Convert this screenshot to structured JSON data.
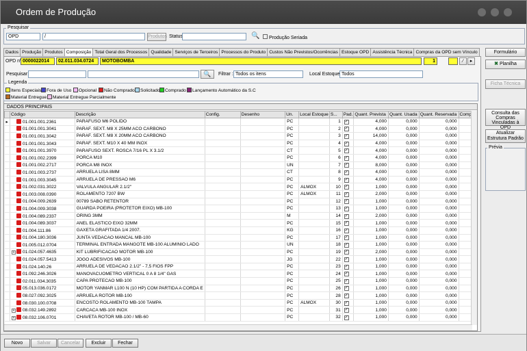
{
  "window": {
    "title": "Ordem de Produção"
  },
  "pesquisar": {
    "legend": "Pesquisar",
    "type_value": "OPD",
    "number_value": "/",
    "produtos_label": "Produtos",
    "status_label": "Status",
    "producao_seriada_label": "Produção Seriada"
  },
  "tabs": [
    "Dados",
    "Produção",
    "Produtos",
    "Composição",
    "Total Geral dos Processos",
    "Qualidade",
    "Serviços de Terceiros",
    "Processos do Produto",
    "Custos Não Previstos/Ocorrências",
    "Estoque OPD",
    "Assistência Técnica",
    "Compras da OPD sem Vínculo"
  ],
  "active_tab": "Composição",
  "opd": {
    "label": "OPD nº",
    "number": "0000022014",
    "code": "02.011.034.0724",
    "name": "MOTOBOMBA",
    "qty": "1"
  },
  "filters": {
    "pesquisar_label": "Pesquisar:",
    "filtrar_label": "Filtrar :",
    "filtrar_value": "Todos os itens",
    "local_estoque_label": "Local Estoque :",
    "local_estoque_value": "Todos"
  },
  "legenda": {
    "title": "Legenda",
    "items": [
      {
        "label": "Itens Especiais",
        "color": "#ffff33"
      },
      {
        "label": "Fora de Uso",
        "color": "#4444cc"
      },
      {
        "label": "Opcional",
        "color": "#f4b8f4"
      },
      {
        "label": "Não Comprado",
        "color": "#dd2222"
      },
      {
        "label": "Solicitado",
        "color": "#a8d8ee"
      },
      {
        "label": "Comprado",
        "color": "#22cc22"
      },
      {
        "label": "Lançamento Automático da S.C",
        "color": "#882277"
      },
      {
        "label": "Material Entregue",
        "color": "#b86a22"
      },
      {
        "label": "Material Entregue Parcialmente",
        "color": "#f0c0e8"
      }
    ]
  },
  "grid": {
    "section_title": "DADOS PRINCIPAIS",
    "columns": [
      "Código",
      "Descrição",
      "Config.",
      "Desenho",
      "Un.",
      "Local Estoque",
      "S...",
      "Pad.",
      "Quant. Prevista",
      "Quant. Usada",
      "Quant. Reservada",
      "Compra"
    ],
    "rows": [
      [
        "01.001.001.2361",
        "PARAFUSO M6 POLIDO",
        "",
        "",
        "PC",
        "",
        "1",
        "4,000",
        "0,000",
        "0,000"
      ],
      [
        "01.001.001.3041",
        "PARAF. SEXT. M8 X 25MM ACO CARBONO",
        "",
        "",
        "PC",
        "",
        "2",
        "4,000",
        "0,000",
        "0,000"
      ],
      [
        "01.001.001.3042",
        "PARAF. SEXT. M8 X 20MM ACO CARBONO",
        "",
        "",
        "PC",
        "",
        "3",
        "14,000",
        "0,000",
        "0,000"
      ],
      [
        "01.001.001.3043",
        "PARAF. SEXT. M10 X 40 MM INOX",
        "",
        "",
        "PC",
        "",
        "4",
        "4,000",
        "0,000",
        "0,000"
      ],
      [
        "01.001.001.3970",
        "PARAFUSO SEXT. ROSCA 7/16 PL X 3.1/2",
        "",
        "",
        "CT",
        "",
        "5",
        "4,000",
        "0,000",
        "0,000"
      ],
      [
        "01.001.002.2399",
        "PORCA M10",
        "",
        "",
        "PC",
        "",
        "6",
        "4,000",
        "0,000",
        "0,000"
      ],
      [
        "01.001.002.2717",
        "PORCA M8 INOX",
        "",
        "",
        "UN",
        "",
        "7",
        "8,000",
        "0,000",
        "0,000"
      ],
      [
        "01.001.003.2737",
        "ARRUELA LISA 8MM",
        "",
        "",
        "CT",
        "",
        "8",
        "4,000",
        "0,000",
        "0,000"
      ],
      [
        "01.001.003.3045",
        "ARRUELA DE PRESSAO M6",
        "",
        "",
        "PC",
        "",
        "9",
        "4,000",
        "0,000",
        "0,000"
      ],
      [
        "01.002.031.3022",
        "VALVULA ANGULAR 2.1/2\"",
        "",
        "",
        "PC",
        "ALMOX",
        "10",
        "1,000",
        "0,000",
        "0,000"
      ],
      [
        "01.003.008.0390",
        "ROLAMENTO 7207 BW",
        "",
        "",
        "PC",
        "ALMOX",
        "11",
        "2,000",
        "0,000",
        "0,000"
      ],
      [
        "01.004.009.2639",
        "00789 SABO RETENTOR",
        "",
        "",
        "PC",
        "",
        "12",
        "1,000",
        "0,000",
        "0,000"
      ],
      [
        "01.004.009.3038",
        "GUARDA POEIRA (PROTETOR EIXO) MB-100",
        "",
        "",
        "PC",
        "",
        "13",
        "1,000",
        "0,000",
        "0,000"
      ],
      [
        "01.004.089.2337",
        "ORING 3MM",
        "",
        "",
        "M",
        "",
        "14",
        "2,000",
        "0,000",
        "0,000"
      ],
      [
        "01.004.089.3037",
        "ANEL ELASTICO EIXO 32MM",
        "",
        "",
        "PC",
        "",
        "15",
        "1,000",
        "0,000",
        "0,000"
      ],
      [
        "01.004.111.86",
        "GAXETA GRAFITADA 1/4 2007.",
        "",
        "",
        "KG",
        "",
        "16",
        "1,000",
        "0,000",
        "0,000"
      ],
      [
        "01.004.180.3036",
        "JUNTA VEDACAO MANCAL MB-100",
        "",
        "",
        "PC",
        "",
        "17",
        "1,000",
        "0,000",
        "0,000"
      ],
      [
        "01.005.012.0704",
        "TERMINAL ENTRADA MANGOTE MB-100 ALUMINIO LADO",
        "",
        "",
        "UN",
        "",
        "18",
        "1,000",
        "0,000",
        "0,000"
      ],
      [
        "01.024.057.4635",
        "KIT LUBRIFICACAO MOTOR MB-100",
        "",
        "",
        "PC",
        "",
        "19",
        "2,000",
        "0,000",
        "0,000"
      ],
      [
        "01.024.057.5413",
        "JOGO ADESIVOS MB-100",
        "",
        "",
        "JG",
        "",
        "22",
        "1,000",
        "0,000",
        "0,000"
      ],
      [
        "01.024.140.26",
        "ARRUELA DE VEDACAO 2.1/2\" - 7,5 FIOS FPP",
        "",
        "",
        "PC",
        "",
        "23",
        "1,000",
        "0,000",
        "0,000"
      ],
      [
        "01.092.246.3026",
        "MANOVACUOMETRO VERTICAL 0 A 8 1/4\" GAS",
        "",
        "",
        "PC",
        "",
        "24",
        "1,000",
        "0,000",
        "0,000"
      ],
      [
        "02.011.034.3035",
        "CAPA PROTECAO MB-100",
        "",
        "",
        "PC",
        "",
        "25",
        "1,000",
        "0,000",
        "0,000"
      ],
      [
        "05.013.036.0172",
        "MOTOR YANMAR L100 N (10 HP) COM PARTIDA A CORDA E",
        "",
        "",
        "PC",
        "",
        "26",
        "1,000",
        "0,000",
        "0,000"
      ],
      [
        "08.027.092.3025",
        "ARRUELA ROTOR MB-100",
        "",
        "",
        "PC",
        "",
        "28",
        "1,000",
        "0,000",
        "0,000"
      ],
      [
        "08.030.100.0708",
        "ENCOSTO ROLAMENTO MB-100 TAMPA",
        "",
        "",
        "PC",
        "ALMOX",
        "30",
        "1,000",
        "0,000",
        "0,000"
      ],
      [
        "08.032.149.2892",
        "CARCACA MB-100 INOX",
        "",
        "",
        "PC",
        "",
        "31",
        "1,000",
        "0,000",
        "0,000"
      ],
      [
        "08.032.106.0701",
        "CHAVETA ROTOR MB-100 / MB-60",
        "",
        "",
        "PC",
        "",
        "32",
        "1,000",
        "0,000",
        "0,000"
      ]
    ]
  },
  "right_panel": {
    "formulario": "Formulário",
    "planilha": "Planilha",
    "ficha_tecnica": "Ficha Técnica",
    "consulta": "Consulta das Compras Vinculadas à OPD",
    "atualizar": "Atualizar Estrutura Padrão",
    "previa": "Prévia"
  },
  "bottom": {
    "novo": "Novo",
    "salvar": "Salvar",
    "cancelar": "Cancelar",
    "excluir": "Excluir",
    "fechar": "Fechar"
  }
}
